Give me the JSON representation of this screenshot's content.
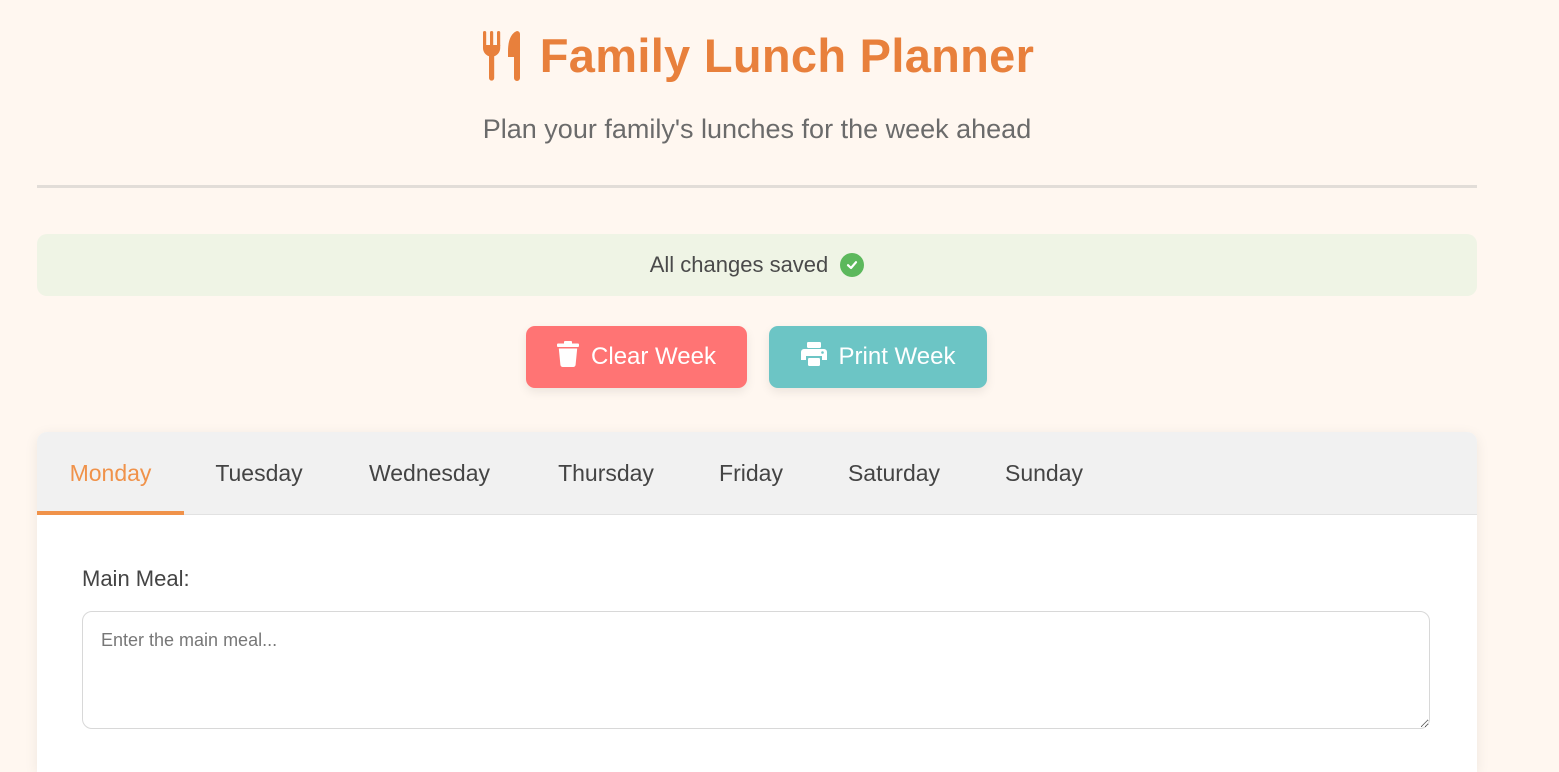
{
  "header": {
    "icon": "utensils-icon",
    "title": "Family Lunch Planner",
    "subtitle": "Plan your family's lunches for the week ahead"
  },
  "status": {
    "text": "All changes saved",
    "icon": "check-circle-icon"
  },
  "actions": {
    "clear_label": "Clear Week",
    "clear_icon": "trash-icon",
    "print_label": "Print Week",
    "print_icon": "printer-icon"
  },
  "tabs": [
    {
      "label": "Monday",
      "active": true
    },
    {
      "label": "Tuesday",
      "active": false
    },
    {
      "label": "Wednesday",
      "active": false
    },
    {
      "label": "Thursday",
      "active": false
    },
    {
      "label": "Friday",
      "active": false
    },
    {
      "label": "Saturday",
      "active": false
    },
    {
      "label": "Sunday",
      "active": false
    }
  ],
  "form": {
    "main_meal_label": "Main Meal:",
    "main_meal_placeholder": "Enter the main meal...",
    "main_meal_value": ""
  },
  "colors": {
    "background": "#fff7f0",
    "accent": "#e8803c",
    "active_tab": "#f0924a",
    "clear_button": "#ff7474",
    "print_button": "#6cc5c5",
    "status_bg": "#eff4e5",
    "success": "#5cb85c"
  }
}
